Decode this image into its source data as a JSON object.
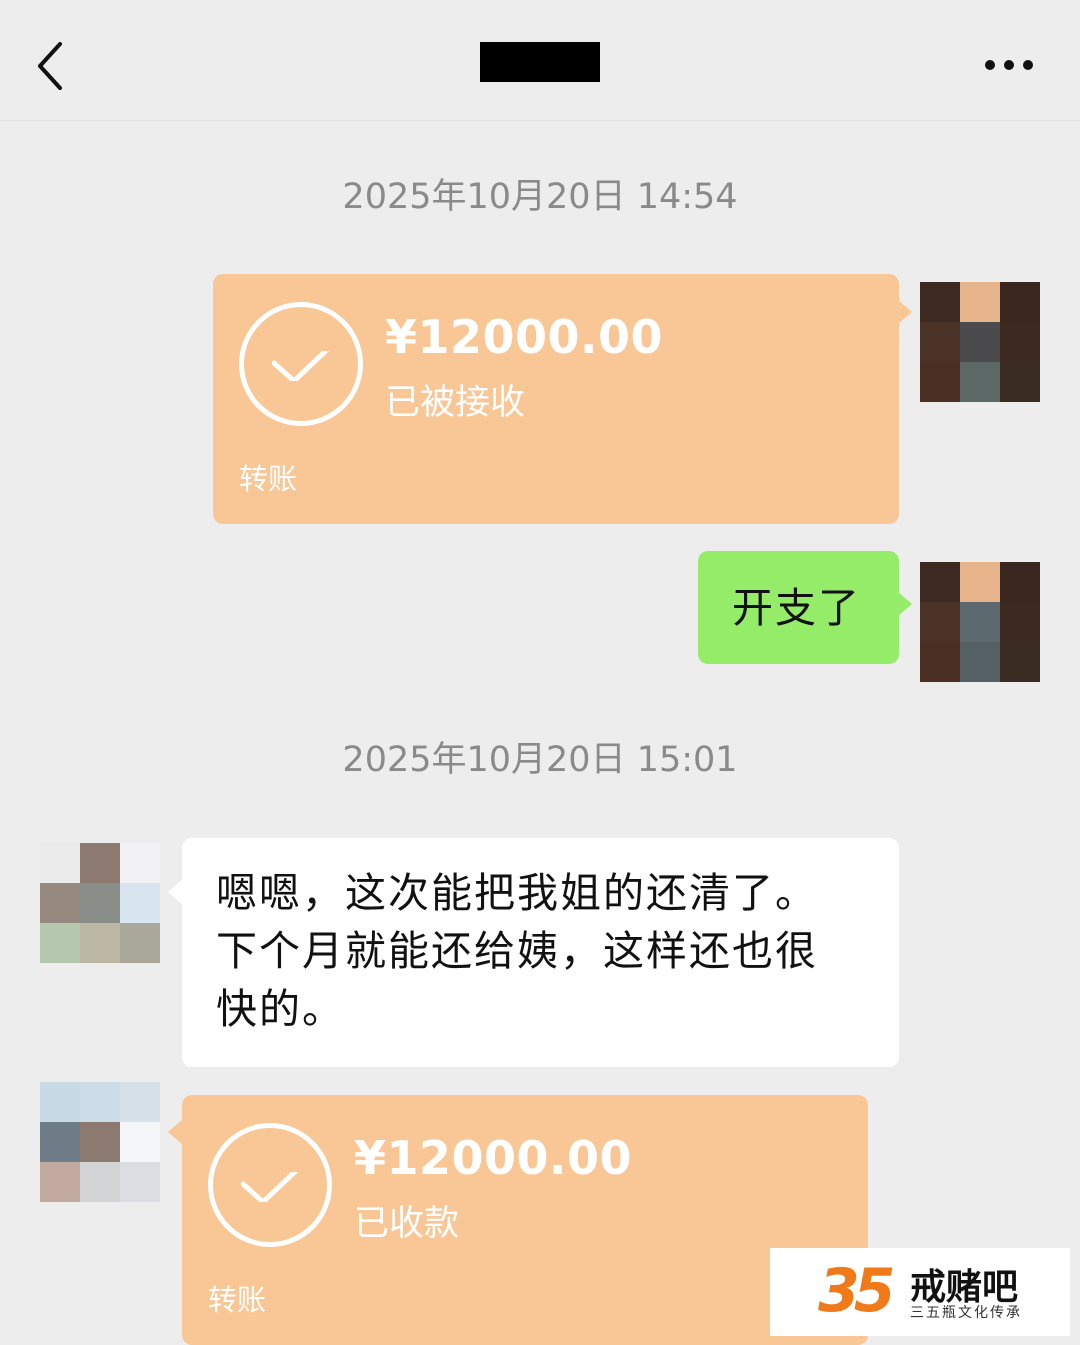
{
  "header": {
    "back_icon": "chevron-left-icon",
    "more_icon": "ellipsis-icon"
  },
  "messages": {
    "time_1": "2025年10月20日 14:54",
    "transfer_out": {
      "amount": "¥12000.00",
      "status": "已被接收",
      "label": "转账"
    },
    "text_out": "开支了",
    "time_2": "2025年10月20日 15:01",
    "text_in_lines": [
      "嗯嗯，这次能把我姐的还清了。",
      "下个月就能还给姨，这样还也很",
      "快的。"
    ],
    "transfer_in": {
      "amount": "¥12000.00",
      "status": "已收款",
      "label": "转账"
    }
  },
  "watermark": {
    "logo_number": "35",
    "name": "戒赌吧",
    "tagline": "三五瓶文化传承"
  },
  "colors": {
    "background": "#ededed",
    "transfer_bubble": "#f9c796",
    "green_bubble": "#95ec69",
    "timestamp": "#8a8a8a"
  }
}
